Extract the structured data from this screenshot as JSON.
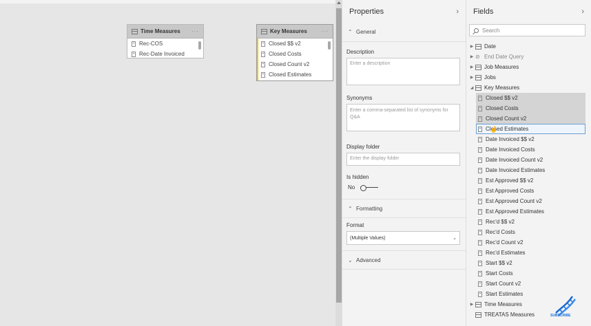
{
  "canvas": {
    "tables": [
      {
        "title": "Time Measures",
        "rows": [
          "Rec-COS",
          "Rec-Date Invoiced"
        ]
      },
      {
        "title": "Key Measures",
        "rows": [
          "Closed $$ v2",
          "Closed Costs",
          "Closed Count v2",
          "Closed Estimates"
        ]
      }
    ]
  },
  "properties": {
    "title": "Properties",
    "general_label": "General",
    "description_label": "Description",
    "description_placeholder": "Enter a description",
    "synonyms_label": "Synonyms",
    "synonyms_placeholder": "Enter a comma-separated list of synonyms for Q&A",
    "display_folder_label": "Display folder",
    "display_folder_placeholder": "Enter the display folder",
    "is_hidden_label": "Is hidden",
    "is_hidden_value": "No",
    "formatting_label": "Formatting",
    "format_label": "Format",
    "format_value": "(Multiple Values)",
    "advanced_label": "Advanced"
  },
  "fields": {
    "title": "Fields",
    "search_placeholder": "Search",
    "items": [
      {
        "label": "Date",
        "kind": "table",
        "expanded": false
      },
      {
        "label": "End Date Query",
        "kind": "hidden-table",
        "expanded": false
      },
      {
        "label": "Job Measures",
        "kind": "table",
        "expanded": false
      },
      {
        "label": "Jobs",
        "kind": "table",
        "expanded": false
      },
      {
        "label": "Key Measures",
        "kind": "table",
        "expanded": true
      }
    ],
    "key_measures": [
      "Closed $$ v2",
      "Closed Costs",
      "Closed Count v2",
      "Closed Estimates",
      "Date Invoiced $$ v2",
      "Date Invoiced Costs",
      "Date Invoiced Count v2",
      "Date Invoiced Estimates",
      "Est Approved $$ v2",
      "Est Approved Costs",
      "Est Approved Count v2",
      "Est Approved Estimates",
      "Rec'd $$ v2",
      "Rec'd Costs",
      "Rec'd Count v2",
      "Rec'd Estimates",
      "Start $$ v2",
      "Start Costs",
      "Start Count v2",
      "Start Estimates"
    ],
    "after_items": [
      {
        "label": "Time Measures",
        "kind": "table"
      },
      {
        "label": "TREATAS Measures",
        "kind": "table"
      }
    ]
  },
  "branding": {
    "subscribe_label": "SUBSCRIBE",
    "accent": "#f2c811",
    "selection": "#6a9fd4"
  }
}
